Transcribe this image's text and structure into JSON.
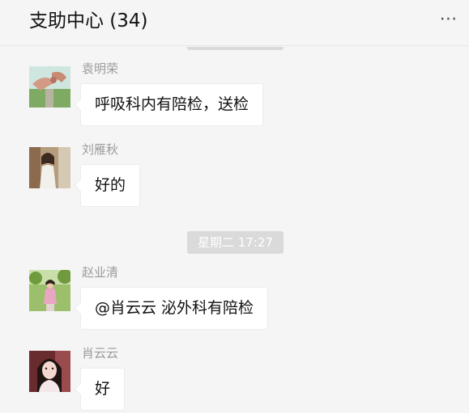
{
  "header": {
    "title": "支助中心 (34)",
    "more_icon": "⋯"
  },
  "messages": [
    {
      "sender": "袁明荣",
      "text": "呼吸科内有陪检，送检",
      "avatar": "hand-photo-avatar"
    },
    {
      "sender": "刘雁秋",
      "text": "好的",
      "avatar": "person-photo-avatar"
    },
    {
      "sender": "赵业清",
      "text": "@肖云云 泌外科有陪检",
      "avatar": "outdoor-photo-avatar"
    },
    {
      "sender": "肖云云",
      "text": "好",
      "avatar": "portrait-photo-avatar"
    }
  ],
  "timestamp": "星期二 17:27"
}
